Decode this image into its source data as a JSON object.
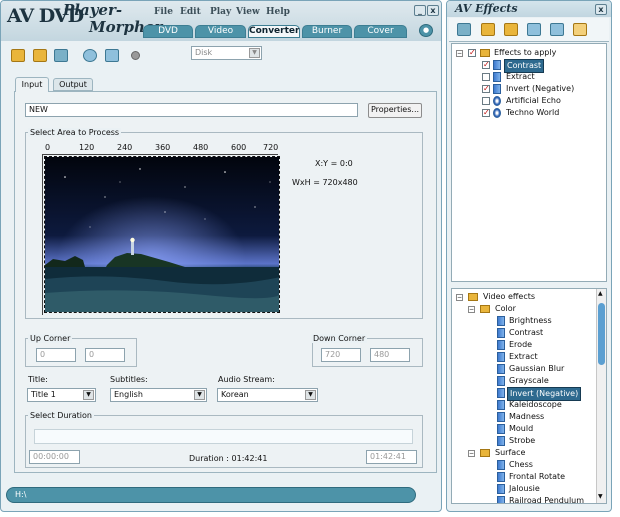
{
  "app": {
    "logo_main": "AV DVD",
    "logo_player": "Player-",
    "logo_morpher": "Morpher"
  },
  "menu": [
    "File",
    "Edit",
    "Play",
    "View",
    "Help"
  ],
  "window_controls": {
    "minimize": "_",
    "close": "x"
  },
  "tabs": [
    "DVD",
    "Video",
    "Converter",
    "Burner",
    "Cover"
  ],
  "toolbar": {
    "disk_select": "Disk"
  },
  "subtabs": [
    "Input",
    "Output"
  ],
  "input": {
    "file_value": "NEW",
    "properties_button": "Properties..."
  },
  "area": {
    "title": "Select Area to Process",
    "ruler_ticks": [
      "0",
      "120",
      "240",
      "360",
      "480",
      "600",
      "720"
    ],
    "xy": "X:Y = 0:0",
    "wxh": "WxH = 720x480"
  },
  "up_corner": {
    "label": "Up Corner",
    "x": "0",
    "y": "0"
  },
  "down_corner": {
    "label": "Down Corner",
    "x": "720",
    "y": "480"
  },
  "title_field": {
    "label": "Title:",
    "value": "Title 1"
  },
  "subtitles": {
    "label": "Subtitles:",
    "value": "English"
  },
  "audio": {
    "label": "Audio Stream:",
    "value": "Korean"
  },
  "duration": {
    "title": "Select Duration",
    "start": "00:00:00",
    "end": "01:42:41",
    "text": "Duration : 01:42:41"
  },
  "statusbar": {
    "path": "H:\\"
  },
  "effects_window": {
    "title": "AV Effects",
    "close": "x"
  },
  "effects_to_apply": {
    "root": "Effects to apply",
    "items": [
      {
        "label": "Contrast",
        "checked": true,
        "selected": true
      },
      {
        "label": "Extract",
        "checked": false
      },
      {
        "label": "Invert (Negative)",
        "checked": true
      },
      {
        "label": "Artificial Echo",
        "checked": false
      },
      {
        "label": "Techno World",
        "checked": true
      }
    ]
  },
  "video_effects": {
    "root": "Video effects",
    "color": {
      "label": "Color",
      "items": [
        "Brightness",
        "Contrast",
        "Erode",
        "Extract",
        "Gaussian Blur",
        "Grayscale",
        "Invert (Negative)",
        "Kaleidoscope",
        "Madness",
        "Mould",
        "Strobe"
      ],
      "selected": "Invert (Negative)"
    },
    "surface": {
      "label": "Surface",
      "items": [
        "Chess",
        "Frontal Rotate",
        "Jalousie",
        "Railroad Pendulum"
      ]
    }
  },
  "colors": {
    "accent": "#4d93a8",
    "selection": "#2e6a8f"
  }
}
